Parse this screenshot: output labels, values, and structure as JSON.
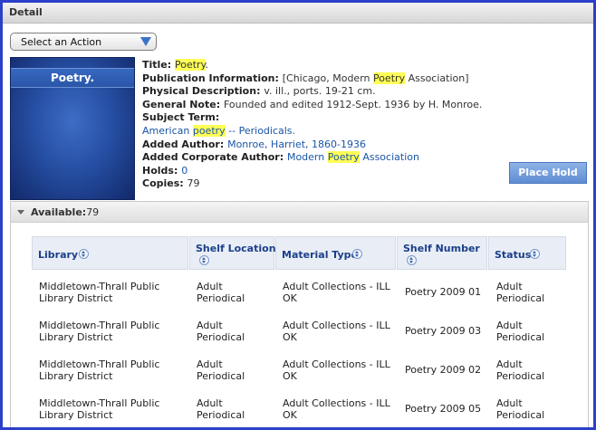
{
  "header": {
    "title": "Detail"
  },
  "action_select": {
    "label": "Select an Action",
    "icon": "chevron-down-icon"
  },
  "cover": {
    "title": "Poetry."
  },
  "record": {
    "title_label": "Title: ",
    "title_value": "Poetry",
    "title_suffix": ".",
    "pub_label": "Publication Information: ",
    "pub_pre": "[Chicago, Modern ",
    "pub_hl": "Poetry",
    "pub_post": " Association]",
    "phys_label": "Physical Description: ",
    "phys_value": "v. ill., ports. 19-21 cm.",
    "note_label": "General Note: ",
    "note_value": "Founded and edited 1912-Sept. 1936 by H. Monroe.",
    "subject_label": "Subject Term:",
    "subject_pre": "American ",
    "subject_hl": "poetry",
    "subject_post": " -- Periodicals.",
    "author_label": "Added Author: ",
    "author_value": "Monroe, Harriet, 1860-1936",
    "corp_label": "Added Corporate Author: ",
    "corp_pre": "Modern ",
    "corp_hl": "Poetry",
    "corp_post": " Association",
    "holds_label": "Holds: ",
    "holds_value": "0",
    "copies_label": "Copies: ",
    "copies_value": "79"
  },
  "place_hold": {
    "label": "Place Hold"
  },
  "availability": {
    "label": "Available:",
    "count": "79"
  },
  "table": {
    "headers": [
      "Library",
      "Shelf Location",
      "Material Type",
      "Shelf Number",
      "Status"
    ],
    "rows": [
      {
        "library": [
          "Middletown-Thrall Public",
          "Library District"
        ],
        "shelf_location": [
          "Adult",
          "Periodical"
        ],
        "material_type": [
          "Adult Collections - ILL",
          "OK"
        ],
        "shelf_number": "Poetry 2009 01",
        "status": [
          "Adult",
          "Periodical"
        ]
      },
      {
        "library": [
          "Middletown-Thrall Public",
          "Library District"
        ],
        "shelf_location": [
          "Adult",
          "Periodical"
        ],
        "material_type": [
          "Adult Collections - ILL",
          "OK"
        ],
        "shelf_number": "Poetry 2009 03",
        "status": [
          "Adult",
          "Periodical"
        ]
      },
      {
        "library": [
          "Middletown-Thrall Public",
          "Library District"
        ],
        "shelf_location": [
          "Adult",
          "Periodical"
        ],
        "material_type": [
          "Adult Collections - ILL",
          "OK"
        ],
        "shelf_number": "Poetry 2009 02",
        "status": [
          "Adult",
          "Periodical"
        ]
      },
      {
        "library": [
          "Middletown-Thrall Public",
          "Library District"
        ],
        "shelf_location": [
          "Adult",
          "Periodical"
        ],
        "material_type": [
          "Adult Collections - ILL",
          "OK"
        ],
        "shelf_number": "Poetry 2009 05",
        "status": [
          "Adult",
          "Periodical"
        ]
      }
    ]
  },
  "colors": {
    "frame_border": "#2b3fc8",
    "link": "#1a55a8",
    "highlight": "#ffff55",
    "place_hold_bg": "#6f9ad9"
  }
}
